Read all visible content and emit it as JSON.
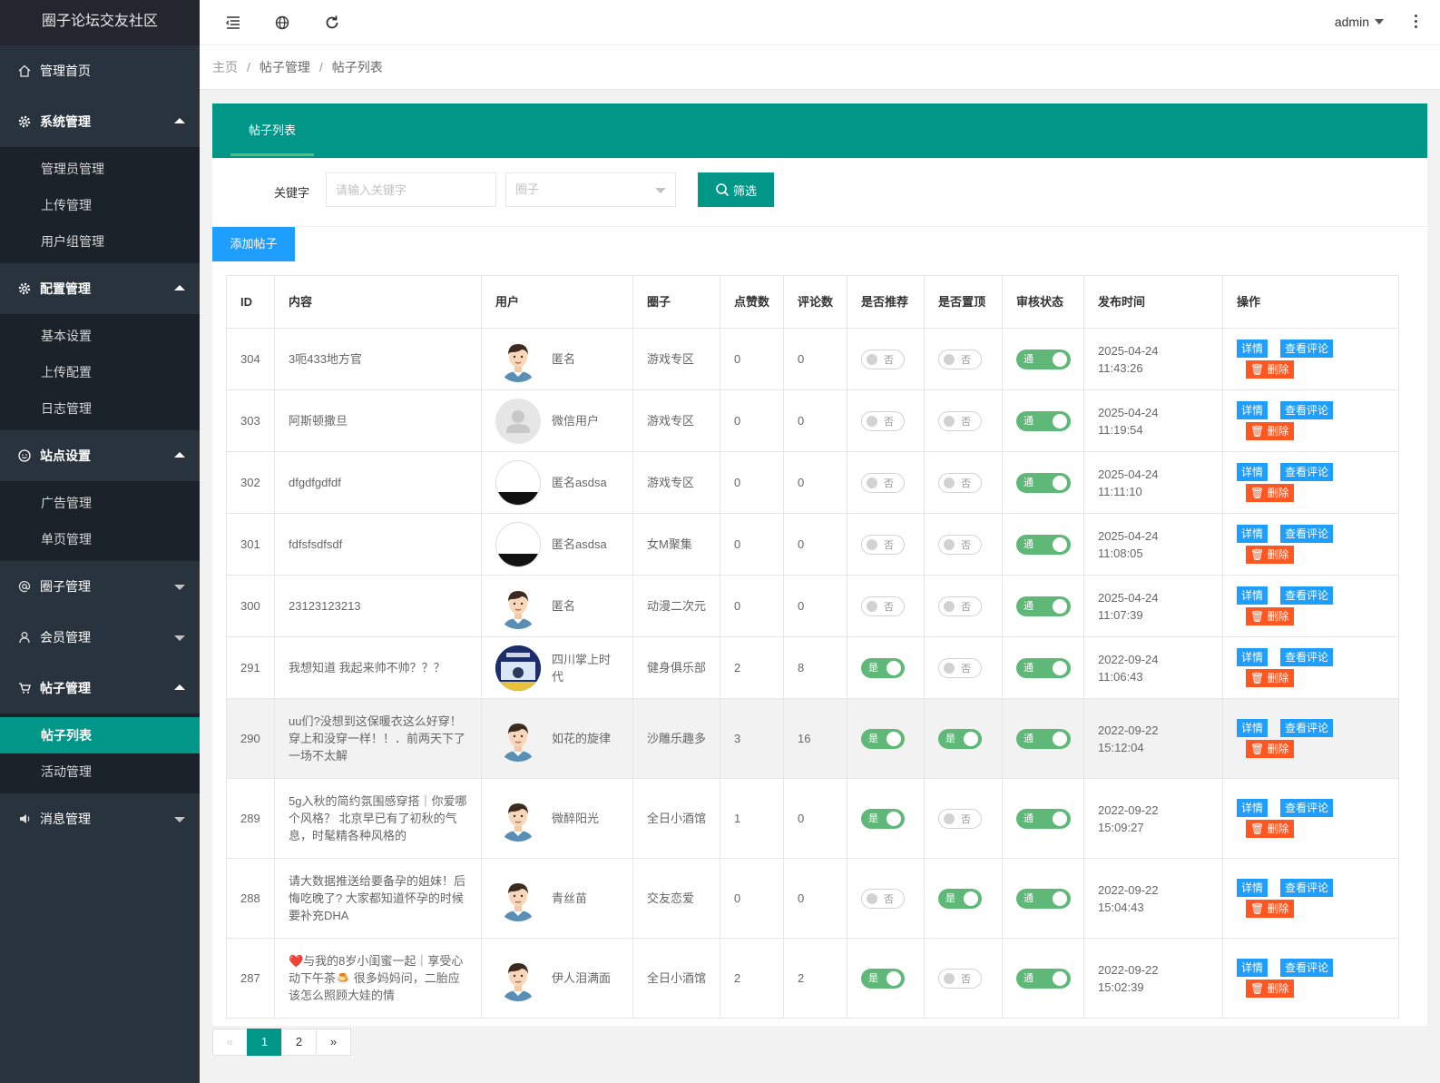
{
  "app": {
    "title": "圈子论坛交友社区"
  },
  "sidebar": {
    "home": "管理首页",
    "groups": [
      {
        "label": "系统管理",
        "expanded": true,
        "items": [
          "管理员管理",
          "上传管理",
          "用户组管理"
        ]
      },
      {
        "label": "配置管理",
        "expanded": true,
        "items": [
          "基本设置",
          "上传配置",
          "日志管理"
        ]
      },
      {
        "label": "站点设置",
        "expanded": true,
        "items": [
          "广告管理",
          "单页管理"
        ]
      },
      {
        "label": "圈子管理",
        "expanded": false,
        "items": []
      },
      {
        "label": "会员管理",
        "expanded": false,
        "items": []
      },
      {
        "label": "帖子管理",
        "expanded": true,
        "items": [
          "帖子列表",
          "活动管理"
        ],
        "active_item": "帖子列表"
      },
      {
        "label": "消息管理",
        "expanded": false,
        "items": []
      }
    ]
  },
  "header": {
    "user": "admin"
  },
  "breadcrumb": [
    "主页",
    "帖子管理",
    "帖子列表"
  ],
  "tab": {
    "label": "帖子列表"
  },
  "filter": {
    "keyword_label": "关键字",
    "keyword_placeholder": "请输入关键字",
    "keyword_value": "",
    "circle_placeholder": "圈子",
    "submit_label": "筛选"
  },
  "add_button": "添加帖子",
  "table": {
    "columns": [
      "ID",
      "内容",
      "用户",
      "圈子",
      "点赞数",
      "评论数",
      "是否推荐",
      "是否置顶",
      "审核状态",
      "发布时间",
      "操作"
    ],
    "switch_on": "是",
    "switch_off": "否",
    "status_on": "通过",
    "actions": {
      "detail": "详情",
      "comments": "查看评论",
      "delete": "删除"
    },
    "rows": [
      {
        "id": "304",
        "content": "3呃433地方官",
        "user": "匿名",
        "avatar": "cartoon",
        "circle": "游戏专区",
        "likes": "0",
        "comments": "0",
        "recommend": false,
        "top": false,
        "time": "2025-04-24 11:43:26"
      },
      {
        "id": "303",
        "content": "阿斯顿撒旦",
        "user": "微信用户",
        "avatar": "default",
        "circle": "游戏专区",
        "likes": "0",
        "comments": "0",
        "recommend": false,
        "top": false,
        "time": "2025-04-24 11:19:54"
      },
      {
        "id": "302",
        "content": "dfgdfgdfdf",
        "user": "匿名asdsa",
        "avatar": "bw",
        "circle": "游戏专区",
        "likes": "0",
        "comments": "0",
        "recommend": false,
        "top": false,
        "time": "2025-04-24 11:11:10"
      },
      {
        "id": "301",
        "content": "fdfsfsdfsdf",
        "user": "匿名asdsa",
        "avatar": "bw",
        "circle": "女M聚集",
        "likes": "0",
        "comments": "0",
        "recommend": false,
        "top": false,
        "time": "2025-04-24 11:08:05"
      },
      {
        "id": "300",
        "content": "23123123213",
        "user": "匿名",
        "avatar": "cartoon",
        "circle": "动漫二次元",
        "likes": "0",
        "comments": "0",
        "recommend": false,
        "top": false,
        "time": "2025-04-24 11:07:39"
      },
      {
        "id": "291",
        "content": "我想知道 我起来帅不帅？？？",
        "user": "四川掌上时代",
        "avatar": "poster",
        "circle": "健身俱乐部",
        "likes": "2",
        "comments": "8",
        "recommend": true,
        "top": false,
        "time": "2022-09-24 11:06:43"
      },
      {
        "id": "290",
        "content": "uu们?没想到这保暖衣这么好穿！穿上和没穿一样！！．前两天下了一场不太解",
        "user": "如花的旋律",
        "avatar": "cartoon",
        "circle": "沙雕乐趣多",
        "likes": "3",
        "comments": "16",
        "recommend": true,
        "top": true,
        "time": "2022-09-22 15:12:04"
      },
      {
        "id": "289",
        "content": "5g入秋的简约氛围感穿搭｜你爱哪个风格？ 北京早已有了初秋的气息，时髦精各种风格的",
        "user": "微醉阳光",
        "avatar": "cartoon",
        "circle": "全日小酒馆",
        "likes": "1",
        "comments": "0",
        "recommend": true,
        "top": false,
        "time": "2022-09-22 15:09:27"
      },
      {
        "id": "288",
        "content": "请大数据推送给要备孕的姐妹！后悔吃晚了? 大家都知道怀孕的时候要补充DHA",
        "user": "青丝苗",
        "avatar": "cartoon",
        "circle": "交友恋爱",
        "likes": "0",
        "comments": "0",
        "recommend": false,
        "top": true,
        "time": "2022-09-22 15:04:43"
      },
      {
        "id": "287",
        "content": "❤️与我的8岁小闺蜜一起｜享受心动下午茶🍮 很多妈妈问，二胎应该怎么照顾大娃的情",
        "user": "伊人泪满面",
        "avatar": "cartoon",
        "circle": "全日小酒馆",
        "likes": "2",
        "comments": "2",
        "recommend": true,
        "top": false,
        "time": "2022-09-22 15:02:39"
      }
    ]
  },
  "pagination": {
    "prev": "«",
    "pages": [
      "1",
      "2"
    ],
    "current": "1",
    "next": "»"
  }
}
